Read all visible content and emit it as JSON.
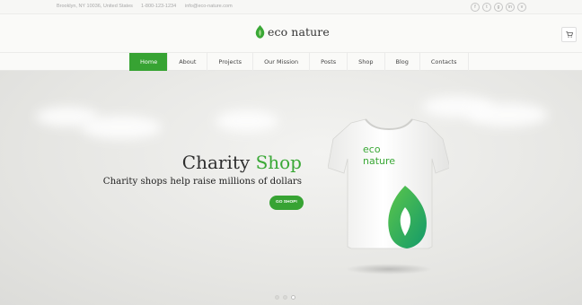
{
  "topbar": {
    "address": "Brooklyn, NY 10036, United States",
    "phone": "1-800-123-1234",
    "email": "info@eco-nature.com",
    "socials": [
      {
        "icon": "facebook-icon",
        "glyph": "f"
      },
      {
        "icon": "twitter-icon",
        "glyph": "t"
      },
      {
        "icon": "google-plus-icon",
        "glyph": "g"
      },
      {
        "icon": "linkedin-icon",
        "glyph": "in"
      },
      {
        "icon": "vimeo-icon",
        "glyph": "v"
      }
    ]
  },
  "header": {
    "logo_text": "eco nature",
    "cart_icon": "cart-icon"
  },
  "nav": {
    "items": [
      {
        "label": "Home",
        "active": true
      },
      {
        "label": "About"
      },
      {
        "label": "Projects"
      },
      {
        "label": "Our Mission"
      },
      {
        "label": "Posts"
      },
      {
        "label": "Shop"
      },
      {
        "label": "Blog"
      },
      {
        "label": "Contacts"
      }
    ]
  },
  "hero": {
    "title_main": "Charity",
    "title_accent": "Shop",
    "subtitle": "Charity shops help raise millions of dollars",
    "button_label": "GO SHOP!",
    "shirt_text_line1": "eco",
    "shirt_text_line2": "nature",
    "slides_total": 3,
    "slide_active": 2
  },
  "colors": {
    "brand_green": "#37a333",
    "background": "#f4f4f2"
  }
}
